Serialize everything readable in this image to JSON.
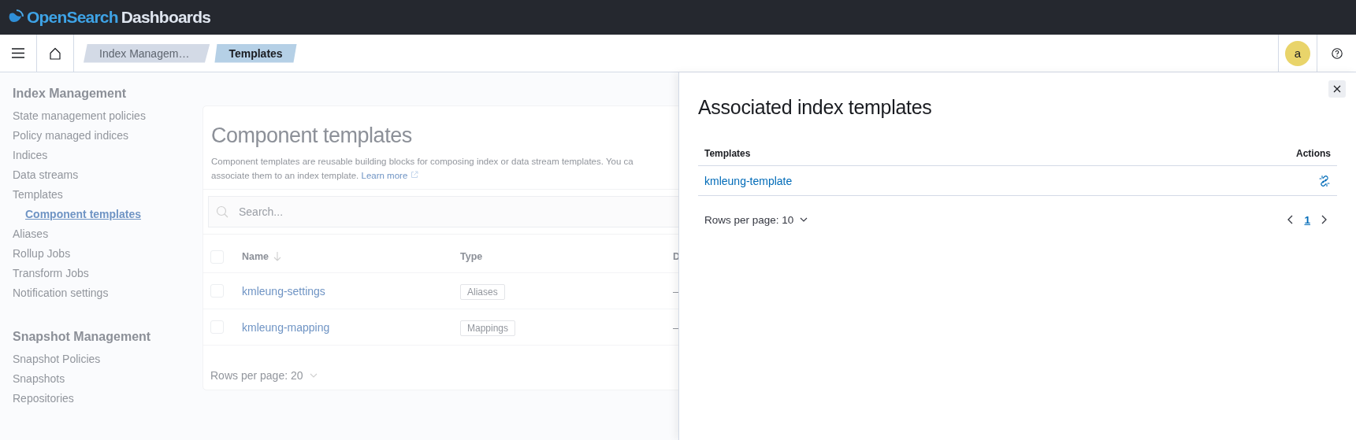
{
  "top_bar": {
    "brand": "OpenSearch",
    "product": "Dashboards"
  },
  "header": {
    "breadcrumbs": [
      {
        "label": "Index Managem…",
        "selected": false
      },
      {
        "label": "Templates",
        "selected": true
      }
    ],
    "avatar": "a"
  },
  "sidebar": {
    "sections": [
      {
        "title": "Index Management",
        "items": [
          {
            "label": "State management policies",
            "selected": false
          },
          {
            "label": "Policy managed indices",
            "selected": false
          },
          {
            "label": "Indices",
            "selected": false
          },
          {
            "label": "Data streams",
            "selected": false
          },
          {
            "label": "Templates",
            "selected": false,
            "children": [
              {
                "label": "Component templates",
                "selected": true
              }
            ]
          },
          {
            "label": "Aliases",
            "selected": false
          },
          {
            "label": "Rollup Jobs",
            "selected": false
          },
          {
            "label": "Transform Jobs",
            "selected": false
          },
          {
            "label": "Notification settings",
            "selected": false
          }
        ]
      },
      {
        "title": "Snapshot Management",
        "items": [
          {
            "label": "Snapshot Policies",
            "selected": false
          },
          {
            "label": "Snapshots",
            "selected": false
          },
          {
            "label": "Repositories",
            "selected": false
          }
        ]
      }
    ]
  },
  "page": {
    "title": "Component templates",
    "description": "Component templates are reusable building blocks for composing index or data stream templates. You ca\nassociate them to an index template.",
    "learn_more": "Learn more",
    "search": {
      "placeholder": "Search..."
    },
    "table": {
      "select_all_checked": false,
      "columns": [
        {
          "label": "Name",
          "sorted": true
        },
        {
          "label": "Type",
          "sorted": false
        },
        {
          "label": "D",
          "sorted": false
        }
      ],
      "rows": [
        {
          "name": "kmleung-settings",
          "type": "Aliases",
          "column_3": "–",
          "checked": false
        },
        {
          "name": "kmleung-mapping",
          "type": "Mappings",
          "column_3": "–",
          "checked": false
        }
      ]
    },
    "rows_per_page": "Rows per page: 20"
  },
  "flyout": {
    "title": "Associated index templates",
    "table": {
      "columns": [
        {
          "label": "Templates"
        },
        {
          "label": "Actions"
        }
      ],
      "rows": [
        {
          "template": "kmleung-template"
        }
      ]
    },
    "rows_per_page": "Rows per page: 10",
    "pages": [
      {
        "label": "1",
        "selected": true
      }
    ]
  }
}
